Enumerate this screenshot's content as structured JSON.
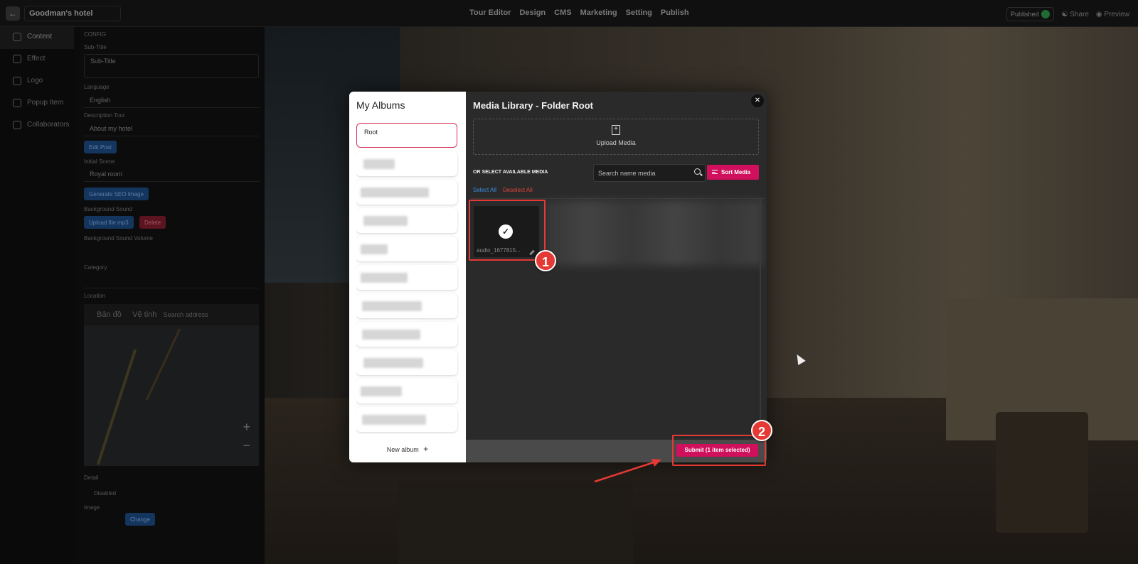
{
  "topbar": {
    "project_title": "Goodman's hotel",
    "nav": [
      "Tour Editor",
      "Design",
      "CMS",
      "Marketing",
      "Setting",
      "Publish"
    ],
    "published_label": "Published",
    "share_label": "Share",
    "preview_label": "Preview"
  },
  "left_nav": {
    "items": [
      {
        "label": "Content",
        "icon": "gear-icon"
      },
      {
        "label": "Effect",
        "icon": "brush-icon"
      },
      {
        "label": "Logo",
        "icon": "copyright-icon"
      },
      {
        "label": "Popup Item",
        "icon": "window-icon"
      },
      {
        "label": "Collaborators",
        "icon": "chat-icon"
      }
    ]
  },
  "settings": {
    "section_label": "CONFIG",
    "subtitle_label": "Sub-Title",
    "subtitle_placeholder": "Sub-Title",
    "language_label": "Language",
    "language_value": "English",
    "description_label": "Description Tour",
    "description_value": "About my hotel",
    "edit_post_label": "Edit Post",
    "initial_scene_label": "Initial Scene",
    "initial_scene_value": "Royal room",
    "generate_seo_label": "Generate SEO Image",
    "bg_sound_label": "Background Sound",
    "upload_mp3_label": "Upload file mp3",
    "delete_label": "Delete",
    "bg_volume_label": "Background Sound Volume",
    "category_label": "Category",
    "location_label": "Location",
    "map_tab_map": "Bản đồ",
    "map_tab_satellite": "Vệ tinh",
    "map_search": "Search address",
    "detail_label": "Detail",
    "disabled_label": "Disabled",
    "image_label": "Image",
    "change_label": "Change"
  },
  "modal": {
    "albums_title": "My Albums",
    "albums": [
      {
        "label": "Root",
        "selected": true
      },
      {
        "label": "",
        "selected": false
      },
      {
        "label": "",
        "selected": false
      },
      {
        "label": "",
        "selected": false
      },
      {
        "label": "",
        "selected": false
      },
      {
        "label": "",
        "selected": false
      },
      {
        "label": "",
        "selected": false
      },
      {
        "label": "",
        "selected": false
      },
      {
        "label": "",
        "selected": false
      },
      {
        "label": "",
        "selected": false
      },
      {
        "label": "",
        "selected": false
      }
    ],
    "new_album_label": "New album",
    "library_title": "Media Library - Folder Root",
    "upload_label": "Upload Media",
    "or_select_label": "OR SELECT AVAILABLE MEDIA",
    "search_placeholder": "Search name media",
    "sort_label": "Sort Media",
    "select_all_label": "Select All",
    "deselect_all_label": "Deselect All",
    "media": [
      {
        "name": "audio_1677815...",
        "selected": true
      }
    ],
    "submit_label": "Submit (1 item selected)"
  },
  "annotations": {
    "step1": "1",
    "step2": "2"
  },
  "colors": {
    "accent": "#d0105c",
    "highlight": "#e53935",
    "link_blue": "#3b8de0",
    "link_red": "#e0433b"
  }
}
